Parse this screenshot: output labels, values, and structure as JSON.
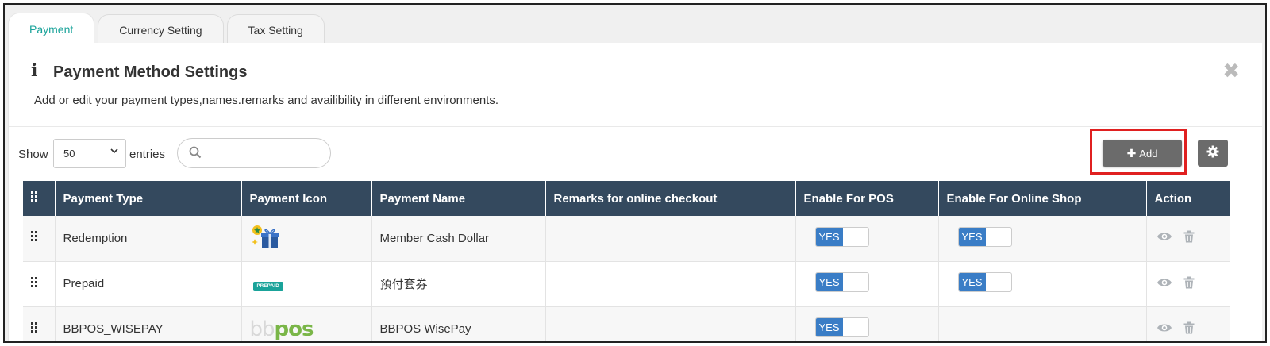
{
  "tabs": [
    {
      "label": "Payment",
      "active": true
    },
    {
      "label": "Currency Setting",
      "active": false
    },
    {
      "label": "Tax Setting",
      "active": false
    }
  ],
  "header": {
    "title": "Payment Method Settings",
    "subtitle": "Add or edit your payment types,names.remarks and availibility in different environments."
  },
  "toolbar": {
    "show_label": "Show",
    "length_value": "50",
    "entries_label": "entries",
    "search_placeholder": "",
    "add_label": "Add"
  },
  "table": {
    "columns": [
      "Payment Type",
      "Payment Icon",
      "Payment Name",
      "Remarks for online checkout",
      "Enable For POS",
      "Enable For Online Shop",
      "Action"
    ],
    "rows": [
      {
        "type": "Redemption",
        "icon": "redemption-gift-icon",
        "name": "Member Cash Dollar",
        "remarks": "",
        "pos": "YES",
        "online": "YES"
      },
      {
        "type": "Prepaid",
        "icon": "prepaid-icon",
        "icon_text": "PREPAID",
        "name": "預付套券",
        "remarks": "",
        "pos": "YES",
        "online": "YES"
      },
      {
        "type": "BBPOS_WISEPAY",
        "icon": "bbpos-logo",
        "icon_text_a": "bb",
        "icon_text_b": "pos",
        "name": "BBPOS WisePay",
        "remarks": "",
        "pos": "YES",
        "online": ""
      }
    ]
  },
  "colors": {
    "accent": "#1aa39a",
    "table_header": "#34495e",
    "toggle_on": "#3a7dc6",
    "button": "#6b6b6b",
    "highlight": "#e02020",
    "bbpos_green": "#7ab648"
  }
}
